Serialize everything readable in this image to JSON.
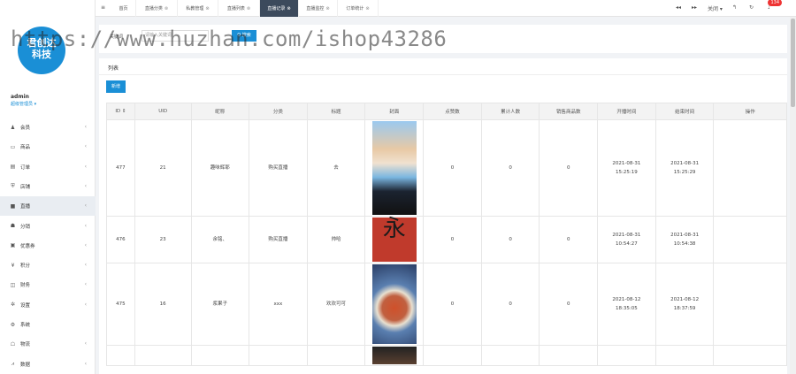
{
  "logo": {
    "line1": "君创达",
    "line2": "科技"
  },
  "user": {
    "name": "admin",
    "role": "超级管理员 ▾"
  },
  "menu": [
    {
      "icon": "♟",
      "label": "会员",
      "chevron": "‹",
      "active": false
    },
    {
      "icon": "▭",
      "label": "商品",
      "chevron": "‹",
      "active": false
    },
    {
      "icon": "▤",
      "label": "订单",
      "chevron": "‹",
      "active": false
    },
    {
      "icon": "⛨",
      "label": "店铺",
      "chevron": "‹",
      "active": false
    },
    {
      "icon": "■",
      "label": "直播",
      "chevron": "‹",
      "active": true
    },
    {
      "icon": "☗",
      "label": "分销",
      "chevron": "‹",
      "active": false
    },
    {
      "icon": "▣",
      "label": "优惠券",
      "chevron": "‹",
      "active": false
    },
    {
      "icon": "¥",
      "label": "积分",
      "chevron": "‹",
      "active": false
    },
    {
      "icon": "◫",
      "label": "财务",
      "chevron": "‹",
      "active": false
    },
    {
      "icon": "✲",
      "label": "设置",
      "chevron": "‹",
      "active": false
    },
    {
      "icon": "⚙",
      "label": "系统",
      "chevron": "",
      "active": false
    },
    {
      "icon": "☖",
      "label": "物流",
      "chevron": "‹",
      "active": false
    },
    {
      "icon": "⩘",
      "label": "数据",
      "chevron": "‹",
      "active": false
    }
  ],
  "topbar": {
    "menu_icon": "≡",
    "tabs": [
      {
        "label": "首页",
        "close": ""
      },
      {
        "label": "直播分类",
        "close": "⊗"
      },
      {
        "label": "私教管理",
        "close": "⊗"
      },
      {
        "label": "直播列表",
        "close": "⊗"
      },
      {
        "label": "直播记录",
        "close": "⊗"
      },
      {
        "label": "直播监控",
        "close": "⊗"
      },
      {
        "label": "订单统计",
        "close": "⊗"
      }
    ],
    "active_tab": 4,
    "prev_icon": "◂◂",
    "next_icon": "▸▸",
    "close_dropdown": "关闭 ▾",
    "back_icon": "↰",
    "refresh_icon": "↻",
    "bell_icon": "♪",
    "badge": "134"
  },
  "search": {
    "label": "关键词",
    "placeholder": "请输入关键词",
    "button": "Q 搜索"
  },
  "list": {
    "title": "列表",
    "add_button": "新增",
    "columns": [
      "ID ⇕",
      "UID",
      "昵称",
      "分类",
      "标题",
      "封面",
      "点赞数",
      "累计人数",
      "销售商品数",
      "开播时间",
      "结束时间",
      "操作"
    ],
    "rows": [
      {
        "id": "477",
        "uid": "21",
        "nickname": "趣味辉耶",
        "category": "购买直播",
        "title": "去",
        "cover": "cover-a",
        "likes": "0",
        "viewers": "0",
        "sales": "0",
        "start_date": "2021-08-31",
        "start_time": "15:25:19",
        "end_date": "2021-08-31",
        "end_time": "15:25:29",
        "actions": ""
      },
      {
        "id": "476",
        "uid": "23",
        "nickname": "余铭、",
        "category": "购买直播",
        "title": "帅哈",
        "cover": "cover-b",
        "likes": "0",
        "viewers": "0",
        "sales": "0",
        "start_date": "2021-08-31",
        "start_time": "10:54:27",
        "end_date": "2021-08-31",
        "end_time": "10:54:38",
        "actions": ""
      },
      {
        "id": "475",
        "uid": "16",
        "nickname": "浆果子",
        "category": "xxx",
        "title": "欢欢可可",
        "cover": "cover-c",
        "likes": "0",
        "viewers": "0",
        "sales": "0",
        "start_date": "2021-08-12",
        "start_time": "18:35:05",
        "end_date": "2021-08-12",
        "end_time": "18:37:59",
        "actions": ""
      },
      {
        "id": "",
        "uid": "",
        "nickname": "",
        "category": "",
        "title": "",
        "cover": "cover-d",
        "likes": "",
        "viewers": "",
        "sales": "",
        "start_date": "",
        "start_time": "",
        "end_date": "",
        "end_time": "",
        "actions": ""
      }
    ],
    "cover_b_char": "永"
  },
  "watermark": "https://www.huzhan.com/ishop43286"
}
